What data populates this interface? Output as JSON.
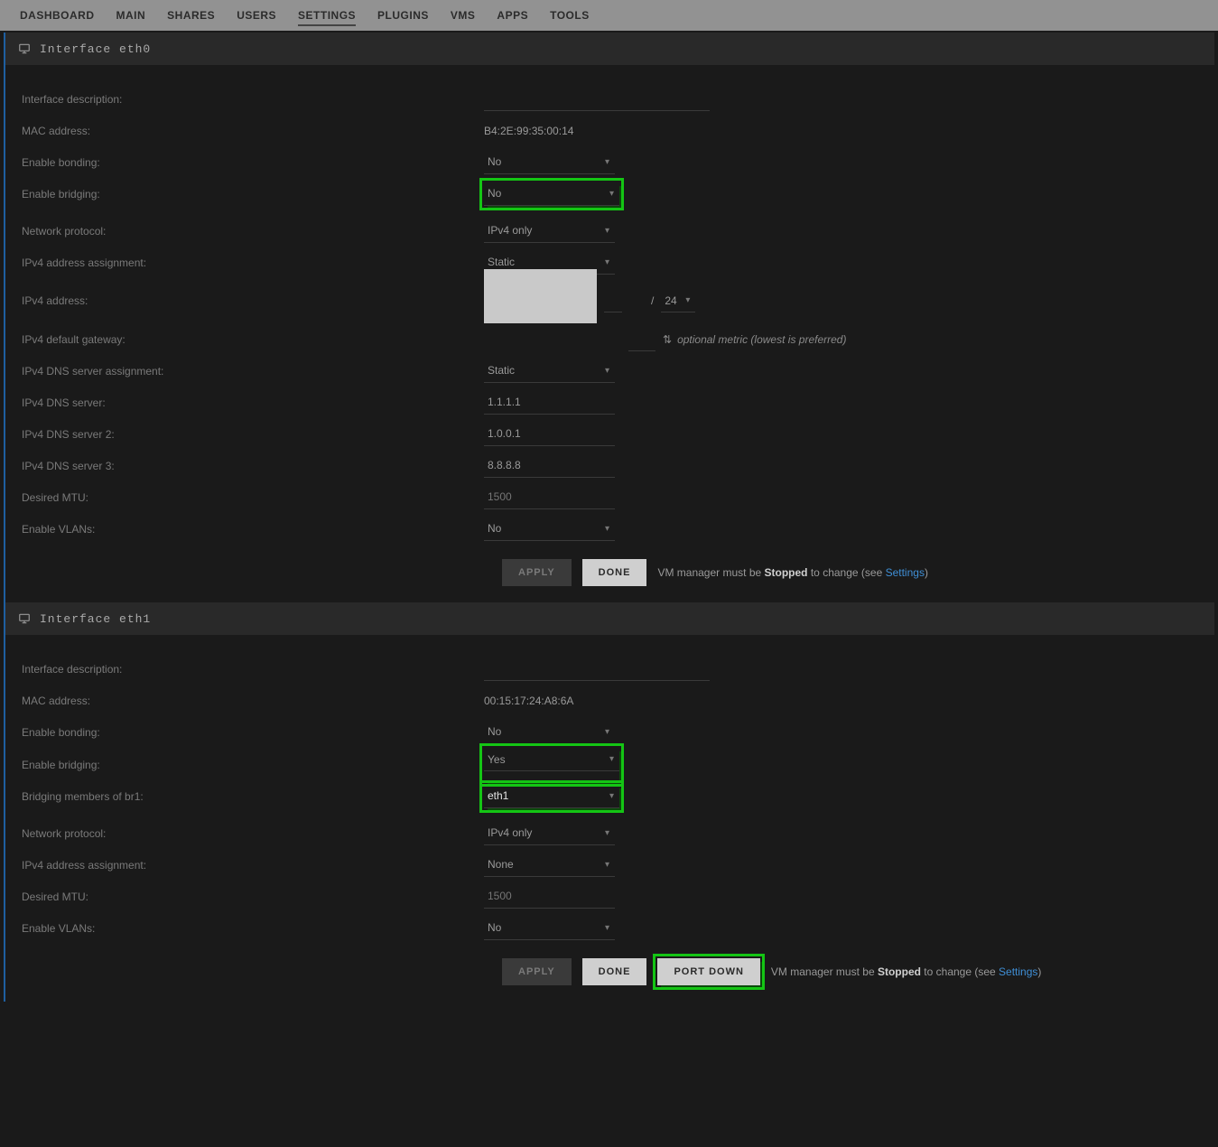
{
  "nav": {
    "tabs": [
      "DASHBOARD",
      "MAIN",
      "SHARES",
      "USERS",
      "SETTINGS",
      "PLUGINS",
      "VMS",
      "APPS",
      "TOOLS"
    ],
    "active": "SETTINGS"
  },
  "eth0": {
    "title": "Interface eth0",
    "labels": {
      "desc": "Interface description:",
      "mac": "MAC address:",
      "bonding": "Enable bonding:",
      "bridging": "Enable bridging:",
      "protocol": "Network protocol:",
      "ipv4assign": "IPv4 address assignment:",
      "ipv4addr": "IPv4 address:",
      "ipv4gw": "IPv4 default gateway:",
      "dnsassign": "IPv4 DNS server assignment:",
      "dns1": "IPv4 DNS server:",
      "dns2": "IPv4 DNS server 2:",
      "dns3": "IPv4 DNS server 3:",
      "mtu": "Desired MTU:",
      "vlans": "Enable VLANs:"
    },
    "values": {
      "desc": "",
      "mac": "B4:2E:99:35:00:14",
      "bonding": "No",
      "bridging": "No",
      "protocol": "IPv4 only",
      "ipv4assign": "Static",
      "mask": "24",
      "dnsassign": "Static",
      "dns1": "1.1.1.1",
      "dns2": "1.0.0.1",
      "dns3": "8.8.8.8",
      "mtu_placeholder": "1500",
      "vlans": "No"
    },
    "metric_hint": "optional metric (lowest is preferred)",
    "buttons": {
      "apply": "APPLY",
      "done": "DONE"
    },
    "note_before": "VM manager must be ",
    "note_bold": "Stopped",
    "note_after": " to change (see ",
    "note_link": "Settings",
    "note_close": ")"
  },
  "eth1": {
    "title": "Interface eth1",
    "labels": {
      "desc": "Interface description:",
      "mac": "MAC address:",
      "bonding": "Enable bonding:",
      "bridging": "Enable bridging:",
      "members": "Bridging members of br1:",
      "protocol": "Network protocol:",
      "ipv4assign": "IPv4 address assignment:",
      "mtu": "Desired MTU:",
      "vlans": "Enable VLANs:"
    },
    "values": {
      "desc": "",
      "mac": "00:15:17:24:A8:6A",
      "bonding": "No",
      "bridging": "Yes",
      "members": "eth1",
      "protocol": "IPv4 only",
      "ipv4assign": "None",
      "mtu_placeholder": "1500",
      "vlans": "No"
    },
    "buttons": {
      "apply": "APPLY",
      "done": "DONE",
      "portdown": "PORT DOWN"
    },
    "note_before": "VM manager must be ",
    "note_bold": "Stopped",
    "note_after": " to change (see ",
    "note_link": "Settings",
    "note_close": ")"
  }
}
